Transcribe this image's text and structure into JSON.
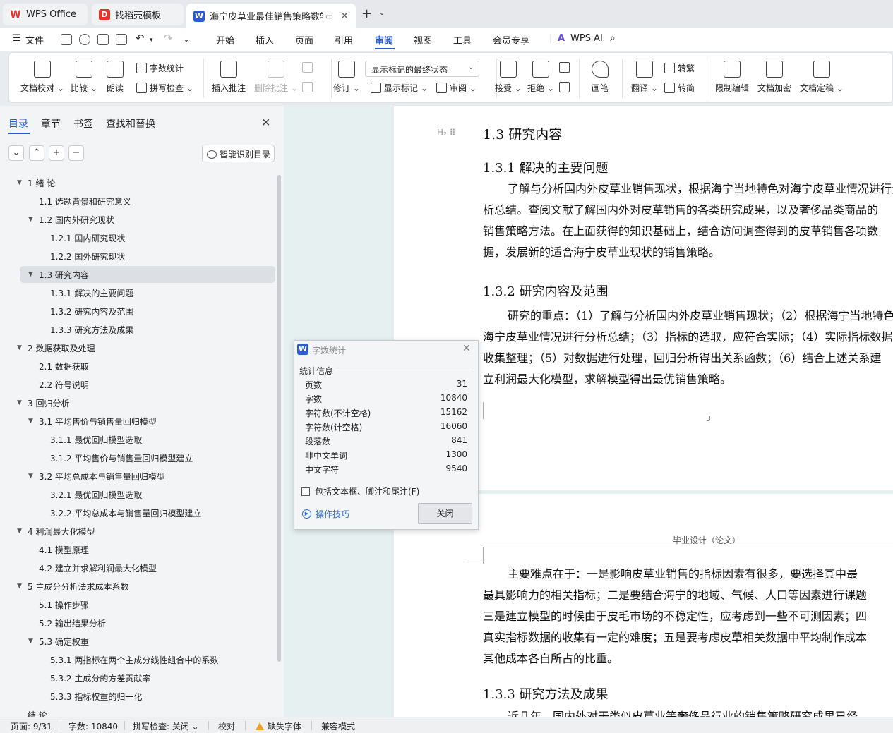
{
  "tabs": [
    {
      "label": "WPS Office",
      "icon": "wps-logo-icon",
      "color": "#e8312b"
    },
    {
      "label": "找稻壳模板",
      "icon": "docer-icon",
      "color": "#e8312b"
    },
    {
      "label": "海宁皮草业最佳销售策略数学",
      "icon": "writer-doc-icon",
      "color": "#2a5bd7"
    }
  ],
  "menu": {
    "file": "文件",
    "items": [
      "开始",
      "插入",
      "页面",
      "引用",
      "审阅",
      "视图",
      "工具",
      "会员专享"
    ],
    "active": "审阅",
    "wps_ai": "WPS AI"
  },
  "ribbon": {
    "doc_check": "文档校对",
    "compare": "比较",
    "read_aloud": "朗读",
    "word_count": "字数统计",
    "spell_check": "拼写检查",
    "insert_comment": "插入批注",
    "delete_comment": "删除批注",
    "revise": "修订",
    "markup_state": "显示标记的最终状态",
    "show_markup": "显示标记",
    "review": "审阅",
    "accept": "接受",
    "reject": "拒绝",
    "pen": "画笔",
    "translate": "翻译",
    "to_traditional": "转繁",
    "to_simplified": "转简",
    "restrict_edit": "限制编辑",
    "encrypt": "文档加密",
    "finalize": "文档定稿"
  },
  "sidebar": {
    "tabs": [
      "目录",
      "章节",
      "书签",
      "查找和替换"
    ],
    "active_tab": "目录",
    "smart_toc": "智能识别目录",
    "toc": [
      {
        "text": "1 绪 论",
        "level": 1,
        "expanded": true
      },
      {
        "text": "1.1 选题背景和研究意义",
        "level": 2
      },
      {
        "text": "1.2 国内外研究现状",
        "level": 2,
        "expanded": true
      },
      {
        "text": "1.2.1 国内研究现状",
        "level": 3
      },
      {
        "text": "1.2.2 国外研究现状",
        "level": 3
      },
      {
        "text": "1.3 研究内容",
        "level": 2,
        "expanded": true,
        "selected": true
      },
      {
        "text": "1.3.1 解决的主要问题",
        "level": 3
      },
      {
        "text": "1.3.2 研究内容及范围",
        "level": 3
      },
      {
        "text": "1.3.3 研究方法及成果",
        "level": 3
      },
      {
        "text": "2 数据获取及处理",
        "level": 1,
        "expanded": true
      },
      {
        "text": "2.1 数据获取",
        "level": 2
      },
      {
        "text": "2.2 符号说明",
        "level": 2
      },
      {
        "text": "3 回归分析",
        "level": 1,
        "expanded": true
      },
      {
        "text": "3.1 平均售价与销售量回归模型",
        "level": 2,
        "expanded": true
      },
      {
        "text": "3.1.1 最优回归模型选取",
        "level": 3
      },
      {
        "text": "3.1.2 平均售价与销售量回归模型建立",
        "level": 3
      },
      {
        "text": "3.2 平均总成本与销售量回归模型",
        "level": 2,
        "expanded": true
      },
      {
        "text": "3.2.1 最优回归模型选取",
        "level": 3
      },
      {
        "text": "3.2.2 平均总成本与销售量回归模型建立",
        "level": 3
      },
      {
        "text": "4 利润最大化模型",
        "level": 1,
        "expanded": true
      },
      {
        "text": "4.1 模型原理",
        "level": 2
      },
      {
        "text": "4.2 建立并求解利润最大化模型",
        "level": 2
      },
      {
        "text": "5 主成分分析法求成本系数",
        "level": 1,
        "expanded": true
      },
      {
        "text": "5.1 操作步骤",
        "level": 2
      },
      {
        "text": "5.2 输出结果分析",
        "level": 2
      },
      {
        "text": "5.3 确定权重",
        "level": 2,
        "expanded": true
      },
      {
        "text": "5.3.1 两指标在两个主成分线性组合中的系数",
        "level": 3
      },
      {
        "text": "5.3.2 主成分的方差贡献率",
        "level": 3
      },
      {
        "text": "5.3.3 指标权重的归一化",
        "level": 3
      },
      {
        "text": "结 论",
        "level": 1
      }
    ]
  },
  "document": {
    "h2_marker": "H₂",
    "s13_title": "1.3  研究内容",
    "s131_title": "1.3.1  解决的主要问题",
    "s131_lines": [
      "了解与分析国内外皮草业销售现状，根据海宁当地特色对海宁皮草业情况进行分",
      "析总结。查阅文献了解国内外对皮草销售的各类研究成果，以及奢侈品类商品的",
      "销售策略方法。在上面获得的知识基础上，结合访问调查得到的皮草销售各项数",
      "据，发展新的适合海宁皮草业现状的销售策略。"
    ],
    "s132_title": "1.3.2  研究内容及范围",
    "s132_lines": [
      "研究的重点：（1）了解与分析国内外皮草业销售现状；（2）根据海宁当地特色对",
      "海宁皮草业情况进行分析总结；（3）指标的选取，应符合实际；（4）实际指标数据的",
      "收集整理；（5）对数据进行处理，回归分析得出关系函数；（6）结合上述关系建",
      "立利润最大化模型，求解模型得出最优销售策略。"
    ],
    "page_number": "3",
    "header_text": "毕业设计（论文）",
    "p2_lines": [
      "主要难点在于：一是影响皮草业销售的指标因素有很多，要选择其中最",
      "最具影响力的相关指标；二是要结合海宁的地域、气候、人口等因素进行课题",
      "三是建立模型的时候由于皮毛市场的不稳定性，应考虑到一些不可测因素；四",
      "真实指标数据的收集有一定的难度；五是要考虑皮草相关数据中平均制作成本",
      "其他成本各自所占的比重。"
    ],
    "s133_title": "1.3.3  研究方法及成果",
    "s133_first": "近几年，国内外对于类似皮草业等奢侈品行业的销售策略研究成果已经"
  },
  "dialog": {
    "title": "字数统计",
    "section": "统计信息",
    "rows": [
      {
        "label": "页数",
        "value": "31"
      },
      {
        "label": "字数",
        "value": "10840"
      },
      {
        "label": "字符数(不计空格)",
        "value": "15162"
      },
      {
        "label": "字符数(计空格)",
        "value": "16060"
      },
      {
        "label": "段落数",
        "value": "841"
      },
      {
        "label": "非中文单词",
        "value": "1300"
      },
      {
        "label": "中文字符",
        "value": "9540"
      }
    ],
    "include_label": "包括文本框、脚注和尾注(F)",
    "include_checked": false,
    "tips": "操作技巧",
    "close": "关闭"
  },
  "status": {
    "page": "页面: 9/31",
    "words": "字数: 10840",
    "spell": "拼写检查: 关闭",
    "proofread": "校对",
    "missing_font": "缺失字体",
    "compat": "兼容模式"
  },
  "colors": {
    "accent": "#2459d8",
    "doc_background": "#e6f0f0",
    "warning": "#f0a020"
  }
}
